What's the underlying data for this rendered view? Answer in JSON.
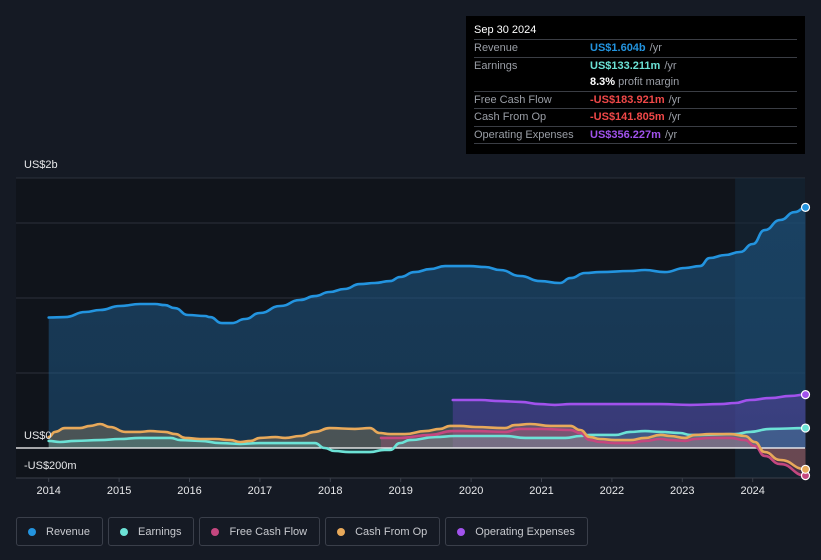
{
  "tooltip": {
    "date": "Sep 30 2024",
    "rows": [
      {
        "label": "Revenue",
        "value": "US$1.604b",
        "unit": "/yr",
        "color": "#2394df"
      },
      {
        "label": "Earnings",
        "value": "US$133.211m",
        "unit": "/yr",
        "color": "#6ce2d6"
      },
      {
        "label": "",
        "margin_value": "8.3%",
        "margin_label": "profit margin"
      },
      {
        "label": "Free Cash Flow",
        "value": "-US$183.921m",
        "unit": "/yr",
        "color": "#f04848"
      },
      {
        "label": "Cash From Op",
        "value": "-US$141.805m",
        "unit": "/yr",
        "color": "#f04848"
      },
      {
        "label": "Operating Expenses",
        "value": "US$356.227m",
        "unit": "/yr",
        "color": "#a152ec"
      }
    ]
  },
  "legend": [
    {
      "label": "Revenue",
      "color": "#2394df"
    },
    {
      "label": "Earnings",
      "color": "#6ce2d6"
    },
    {
      "label": "Free Cash Flow",
      "color": "#c4477f"
    },
    {
      "label": "Cash From Op",
      "color": "#e8a95a"
    },
    {
      "label": "Operating Expenses",
      "color": "#a152ec"
    }
  ],
  "chart_data": {
    "type": "area",
    "title": "",
    "xlabel": "",
    "ylabel": "",
    "y_unit": "US$ millions",
    "ylim": [
      -200,
      1800
    ],
    "y_tick_labels": [
      {
        "value": 2000,
        "label": "US$2b"
      },
      {
        "value": 0,
        "label": "US$0"
      },
      {
        "value": -200,
        "label": "-US$200m"
      }
    ],
    "gridlines_at": [
      1800,
      1500,
      1000,
      500,
      0
    ],
    "grid": true,
    "xlim": [
      2013.9,
      2024.75
    ],
    "x_tick_labels": [
      "2014",
      "2015",
      "2016",
      "2017",
      "2018",
      "2019",
      "2020",
      "2021",
      "2022",
      "2023",
      "2024"
    ],
    "x_ticks": [
      2014,
      2015,
      2016,
      2017,
      2018,
      2019,
      2020,
      2021,
      2022,
      2023,
      2024
    ],
    "highlight_range": [
      2023.75,
      2024.75
    ],
    "legend_position": "bottom",
    "series": [
      {
        "name": "Revenue",
        "color": "#2394df",
        "key": "revenue",
        "x": [
          2014.0,
          2014.23,
          2014.52,
          2014.73,
          2015.01,
          2015.3,
          2015.51,
          2015.65,
          2015.79,
          2015.98,
          2016.22,
          2016.29,
          2016.46,
          2016.6,
          2016.79,
          2017.0,
          2017.29,
          2017.57,
          2017.78,
          2017.99,
          2018.2,
          2018.42,
          2018.63,
          2018.85,
          2018.99,
          2019.2,
          2019.42,
          2019.63,
          2019.98,
          2020.2,
          2020.41,
          2020.7,
          2020.98,
          2021.26,
          2021.41,
          2021.62,
          2021.83,
          2022.26,
          2022.47,
          2022.75,
          2023.04,
          2023.25,
          2023.39,
          2023.61,
          2023.82,
          2024.0,
          2024.17,
          2024.39,
          2024.6,
          2024.75
        ],
        "values": [
          870,
          873,
          907,
          920,
          947,
          960,
          960,
          953,
          933,
          887,
          880,
          873,
          833,
          833,
          860,
          900,
          947,
          987,
          1013,
          1040,
          1060,
          1093,
          1100,
          1113,
          1140,
          1173,
          1193,
          1213,
          1213,
          1207,
          1187,
          1147,
          1113,
          1100,
          1133,
          1167,
          1173,
          1180,
          1187,
          1173,
          1200,
          1213,
          1267,
          1287,
          1307,
          1360,
          1453,
          1520,
          1573,
          1604
        ]
      },
      {
        "name": "Earnings",
        "color": "#6ce2d6",
        "key": "earnings",
        "x": [
          2014.0,
          2014.16,
          2014.37,
          2014.73,
          2015.01,
          2015.3,
          2015.73,
          2015.87,
          2016.15,
          2016.44,
          2016.72,
          2017.0,
          2017.36,
          2017.57,
          2017.78,
          2017.92,
          2018.06,
          2018.27,
          2018.56,
          2018.77,
          2018.85,
          2018.99,
          2019.13,
          2019.49,
          2019.77,
          2020.06,
          2020.48,
          2020.77,
          2021.05,
          2021.34,
          2021.55,
          2021.69,
          2021.83,
          2022.05,
          2022.26,
          2022.47,
          2022.69,
          2022.97,
          2023.11,
          2023.25,
          2023.75,
          2023.96,
          2024.25,
          2024.75
        ],
        "values": [
          47,
          40,
          47,
          53,
          60,
          67,
          67,
          53,
          47,
          33,
          27,
          33,
          33,
          33,
          33,
          0,
          -20,
          -27,
          -27,
          -13,
          -13,
          33,
          53,
          73,
          80,
          80,
          80,
          67,
          67,
          67,
          80,
          87,
          87,
          87,
          107,
          113,
          107,
          100,
          87,
          87,
          93,
          107,
          127,
          133
        ]
      },
      {
        "name": "Free Cash Flow",
        "color": "#c4477f",
        "key": "fcf",
        "x": [
          2018.72,
          2018.99,
          2019.42,
          2019.73,
          2020.06,
          2020.48,
          2020.69,
          2020.98,
          2021.41,
          2021.55,
          2021.69,
          2021.83,
          2022.05,
          2022.26,
          2022.47,
          2022.69,
          2022.83,
          2023.04,
          2023.18,
          2023.39,
          2023.68,
          2023.89,
          2024.03,
          2024.17,
          2024.39,
          2024.75
        ],
        "values": [
          67,
          67,
          87,
          113,
          113,
          107,
          127,
          127,
          120,
          100,
          53,
          40,
          33,
          33,
          47,
          60,
          53,
          47,
          60,
          67,
          67,
          53,
          13,
          -53,
          -107,
          -184
        ]
      },
      {
        "name": "Cash From Op",
        "color": "#e8a95a",
        "key": "cfo",
        "x": [
          2014.0,
          2014.09,
          2014.23,
          2014.44,
          2014.59,
          2014.73,
          2014.87,
          2015.09,
          2015.3,
          2015.44,
          2015.65,
          2015.8,
          2015.94,
          2016.15,
          2016.37,
          2016.58,
          2016.72,
          2016.87,
          2017.0,
          2017.22,
          2017.36,
          2017.57,
          2017.78,
          2017.99,
          2018.35,
          2018.56,
          2018.7,
          2018.85,
          2019.06,
          2019.35,
          2019.56,
          2019.7,
          2019.84,
          2020.06,
          2020.48,
          2020.62,
          2020.84,
          2021.13,
          2021.41,
          2021.55,
          2021.69,
          2021.83,
          2022.05,
          2022.26,
          2022.47,
          2022.69,
          2022.83,
          2023.04,
          2023.18,
          2023.39,
          2023.68,
          2023.89,
          2024.03,
          2024.17,
          2024.39,
          2024.75
        ],
        "values": [
          73,
          107,
          133,
          133,
          147,
          160,
          140,
          107,
          107,
          113,
          107,
          93,
          67,
          60,
          60,
          53,
          40,
          47,
          67,
          73,
          67,
          80,
          107,
          133,
          127,
          133,
          100,
          93,
          93,
          113,
          127,
          147,
          147,
          140,
          133,
          153,
          160,
          147,
          147,
          120,
          73,
          60,
          53,
          53,
          67,
          87,
          80,
          67,
          87,
          93,
          93,
          80,
          40,
          -27,
          -80,
          -142
        ]
      },
      {
        "name": "Operating Expenses",
        "color": "#a152ec",
        "key": "opex",
        "x": [
          2019.74,
          2020.13,
          2020.41,
          2020.7,
          2020.98,
          2021.19,
          2021.41,
          2021.83,
          2022.26,
          2022.69,
          2023.11,
          2023.54,
          2023.75,
          2023.96,
          2024.25,
          2024.54,
          2024.75
        ],
        "values": [
          320,
          320,
          313,
          307,
          293,
          287,
          293,
          293,
          293,
          293,
          287,
          293,
          300,
          320,
          333,
          347,
          356
        ]
      }
    ]
  }
}
